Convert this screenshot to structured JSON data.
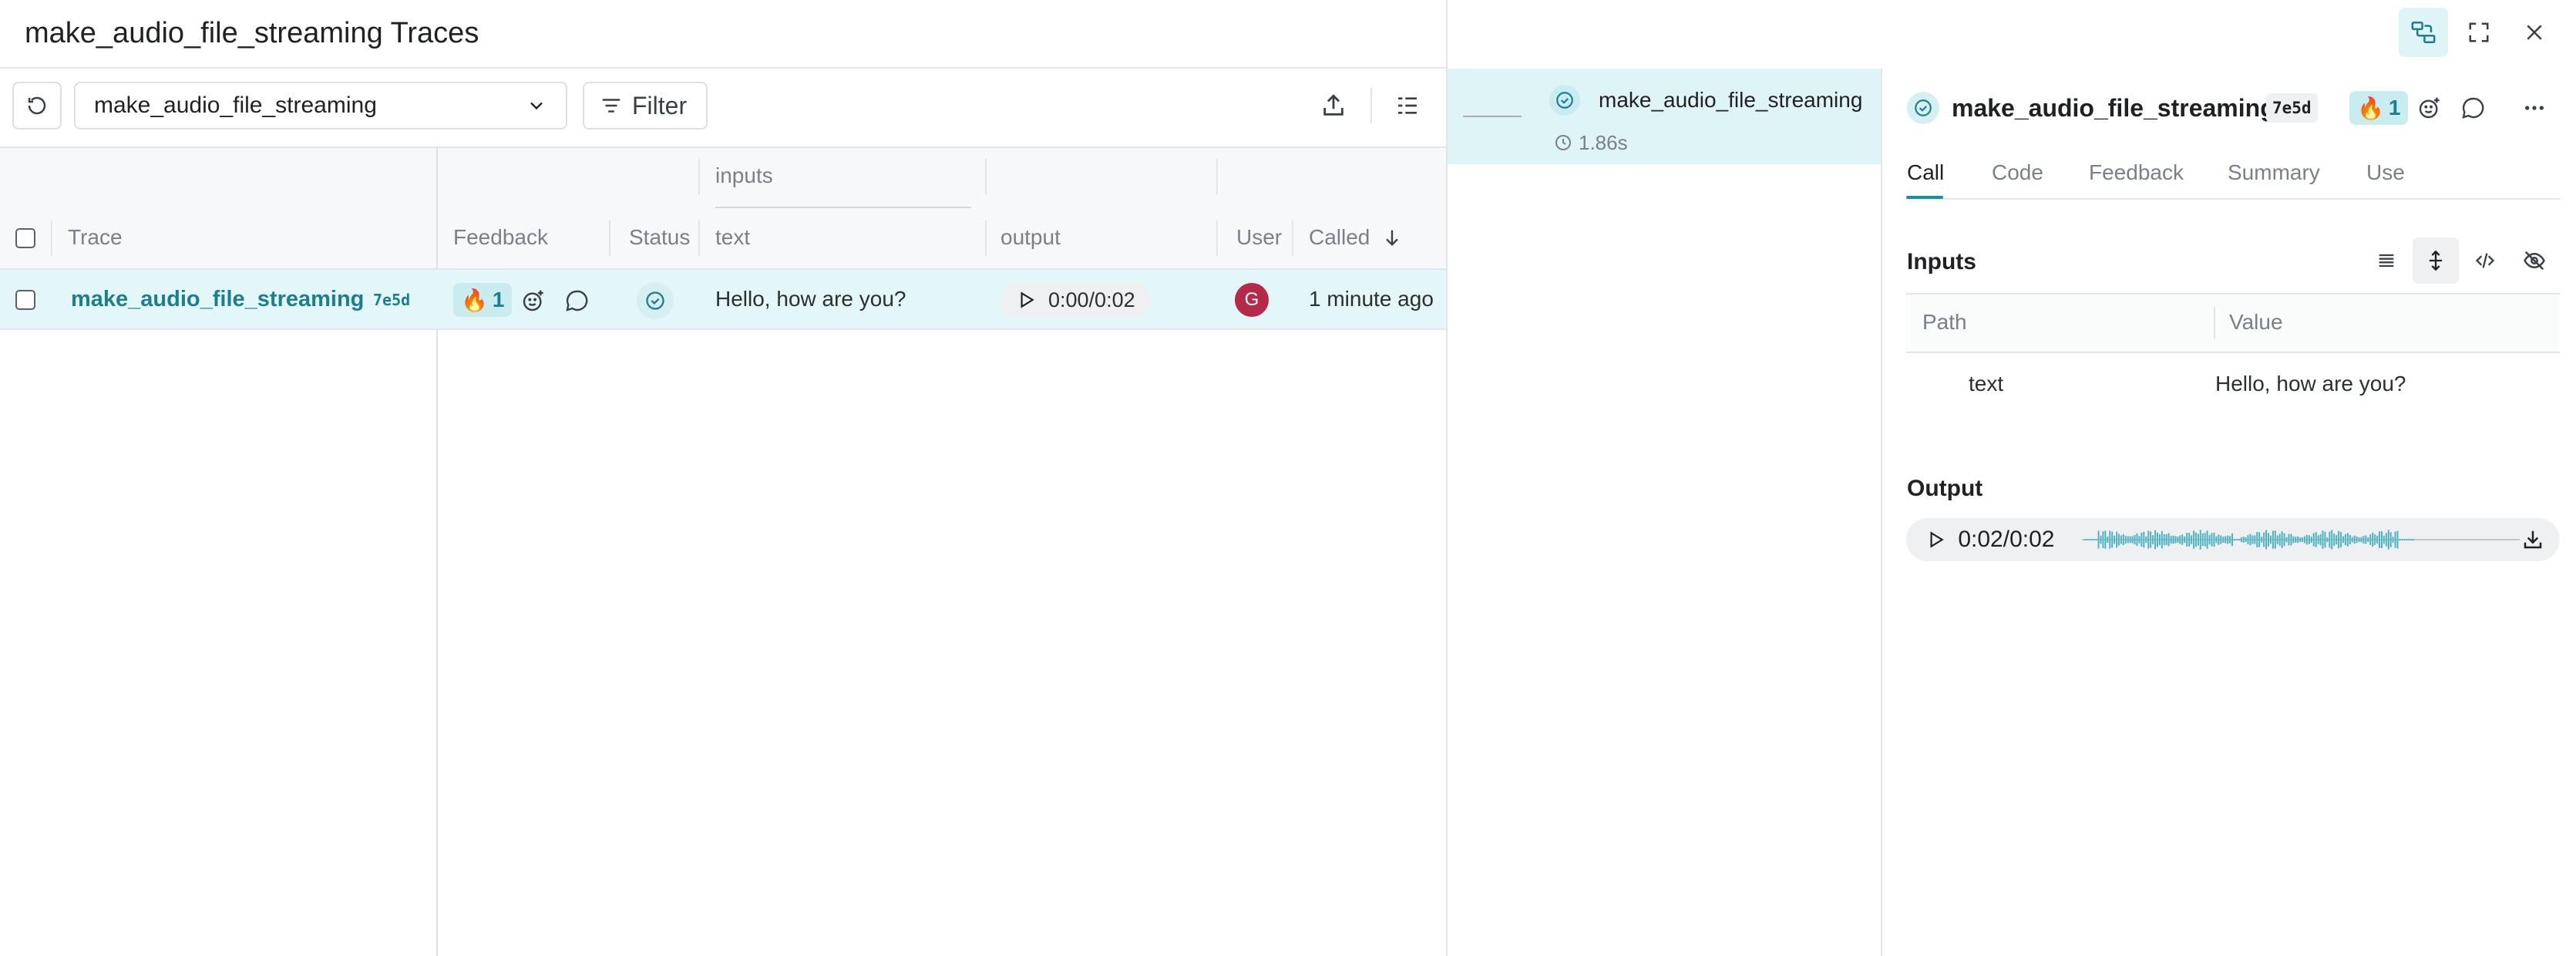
{
  "header": {
    "title": "make_audio_file_streaming Traces"
  },
  "toolbar": {
    "view_select_value": "make_audio_file_streaming",
    "filter_label": "Filter"
  },
  "table": {
    "group_header": "inputs",
    "columns": [
      "Trace",
      "Feedback",
      "Status",
      "text",
      "output",
      "User",
      "Called"
    ],
    "rows": [
      {
        "trace": "make_audio_file_streaming",
        "hash": "7e5d",
        "feedback_emoji": "🔥",
        "feedback_count": "1",
        "text": "Hello, how are you?",
        "output_time": "0:00/0:02",
        "user_initial": "G",
        "called": "1 minute ago"
      }
    ]
  },
  "tree": {
    "name": "make_audio_file_streaming",
    "duration": "1.86s"
  },
  "detail": {
    "title": "make_audio_file_streaming",
    "hash": "7e5d",
    "feedback_emoji": "🔥",
    "feedback_count": "1",
    "tabs": [
      "Call",
      "Code",
      "Feedback",
      "Summary",
      "Use"
    ],
    "inputs_title": "Inputs",
    "path_header": "Path",
    "value_header": "Value",
    "input_path": "text",
    "input_value": "Hello, how are you?",
    "output_title": "Output",
    "audio_time": "0:02/0:02"
  },
  "colors": {
    "accent": "#1b7f8d",
    "selected_row": "#e3f6f8",
    "avatar": "#b5294a",
    "waveform": "#4ab3c2"
  }
}
